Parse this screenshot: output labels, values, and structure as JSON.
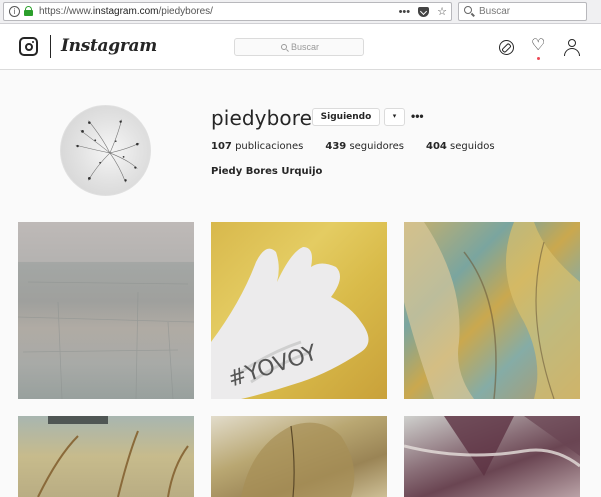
{
  "browser": {
    "url_prefix": "https://www.",
    "url_host": "instagram.com",
    "url_path": "/piedybores/",
    "more_label": "•••",
    "star_label": "☆",
    "search_placeholder": "Buscar"
  },
  "header": {
    "wordmark": "Instagram",
    "search_placeholder": "Buscar",
    "heart_glyph": "♡"
  },
  "profile": {
    "username": "piedybores",
    "follow_label": "Siguiendo",
    "dropdown_glyph": "▾",
    "more_label": "•••",
    "stats": [
      {
        "count": "107",
        "label": "publicaciones"
      },
      {
        "count": "439",
        "label": "seguidores"
      },
      {
        "count": "404",
        "label": "seguidos"
      }
    ],
    "full_name": "Piedy Bores Urquijo"
  },
  "posts": [
    {
      "alt": "gray abstract painting"
    },
    {
      "alt": "hand with #Yovoy written"
    },
    {
      "alt": "gold and teal abstract"
    },
    {
      "alt": "teal and gold abstract"
    },
    {
      "alt": "olive leaf painting"
    },
    {
      "alt": "mauve abstract painting"
    }
  ],
  "colors": {
    "notification": "#ed4956",
    "secure_lock": "#2b9f2b",
    "border": "#dbdbdb",
    "text": "#262626"
  }
}
